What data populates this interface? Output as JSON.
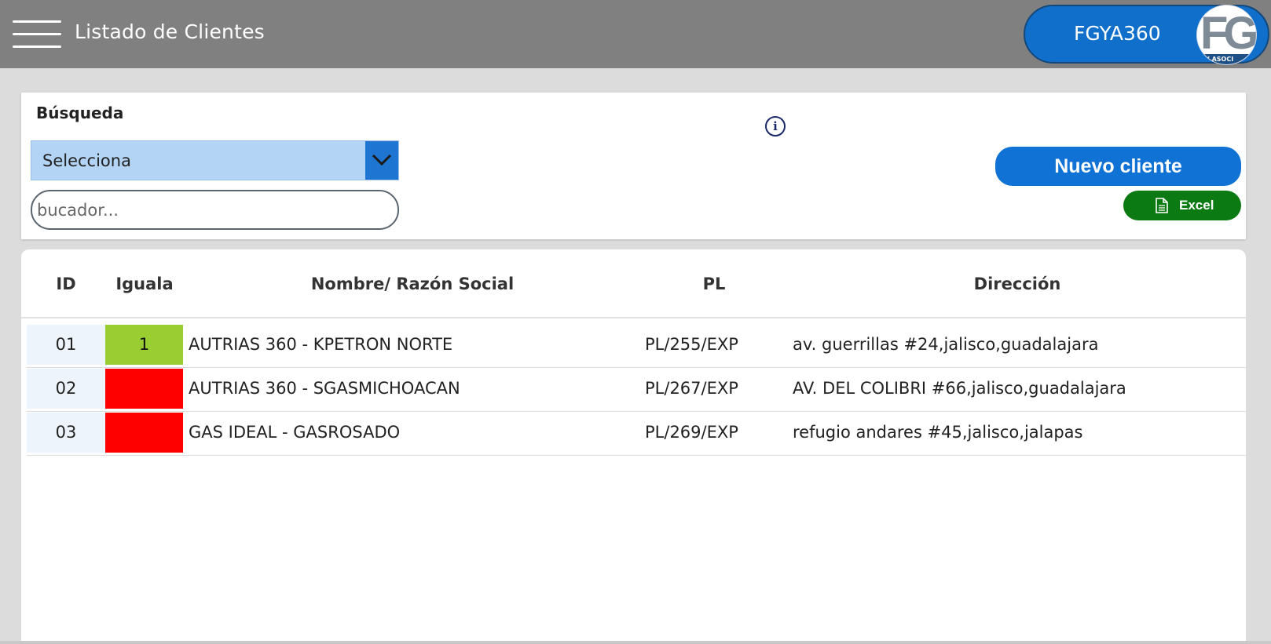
{
  "header": {
    "title": "Listado de Clientes",
    "brand": "FGYA360",
    "logo_letters": "FG",
    "logo_band_text": "Y ASOCI"
  },
  "search": {
    "label": "Búsqueda",
    "select_value": "Selecciona",
    "input_placeholder": "bucador...",
    "new_client_label": "Nuevo cliente",
    "excel_label": "Excel"
  },
  "table": {
    "headers": {
      "id": "ID",
      "iguala": "Iguala",
      "name": "Nombre/ Razón Social",
      "pl": "PL",
      "address": "Dirección"
    },
    "rows": [
      {
        "id": "01",
        "iguala": "1",
        "iguala_color": "#9acd32",
        "name": "AUTRIAS 360 - KPETRON NORTE",
        "pl": "PL/255/EXP",
        "address": "av. guerrillas #24,jalisco,guadalajara"
      },
      {
        "id": "02",
        "iguala": "",
        "iguala_color": "#ff0000",
        "name": "AUTRIAS 360 - SGASMICHOACAN",
        "pl": "PL/267/EXP",
        "address": "AV. DEL COLIBRI #66,jalisco,guadalajara"
      },
      {
        "id": "03",
        "iguala": "",
        "iguala_color": "#ff0000",
        "name": "GAS IDEAL - GASROSADO",
        "pl": "PL/269/EXP",
        "address": "refugio andares #45,jalisco,jalapas"
      }
    ]
  },
  "colors": {
    "header_bg": "#808080",
    "brand_blue": "#0f72d4",
    "excel_green": "#0b7a13",
    "select_bg": "#b3d4f5"
  }
}
